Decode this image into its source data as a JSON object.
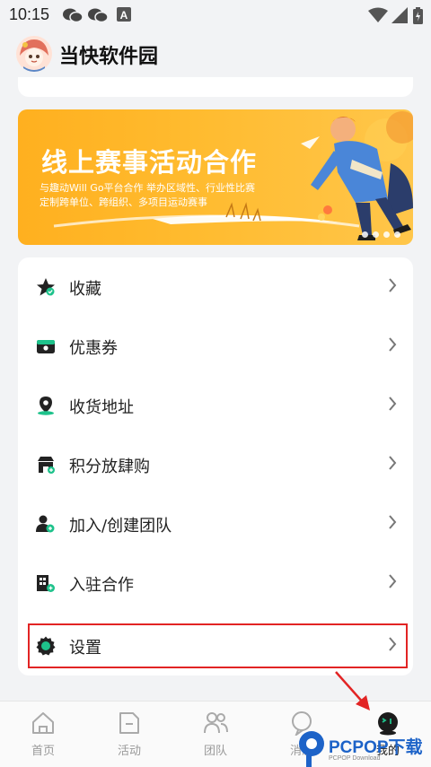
{
  "status_bar": {
    "time": "10:15",
    "icons": [
      "wechat-icon",
      "wechat-icon",
      "a-notification-icon",
      "wifi-icon",
      "signal-icon",
      "battery-icon"
    ]
  },
  "header": {
    "title": "当快软件园",
    "avatar": "avatar-cartoon-girl"
  },
  "banner": {
    "title": "线上赛事活动合作",
    "subtitle_line1": "与趣动Will Go平台合作 举办区域性、行业性比赛",
    "subtitle_line2": "定制跨单位、跨组织、多项目运动赛事",
    "page_count": 4
  },
  "menu": {
    "items": [
      {
        "label": "收藏",
        "icon": "star-favorite-icon"
      },
      {
        "label": "优惠券",
        "icon": "coupon-icon"
      },
      {
        "label": "收货地址",
        "icon": "location-pin-icon"
      },
      {
        "label": "积分放肆购",
        "icon": "points-shop-icon"
      },
      {
        "label": "加入/创建团队",
        "icon": "add-team-icon"
      },
      {
        "label": "入驻合作",
        "icon": "building-cooperation-icon"
      },
      {
        "label": "设置",
        "icon": "gear-icon"
      }
    ],
    "highlighted": "设置"
  },
  "tabbar": {
    "tabs": [
      {
        "label": "首页",
        "icon": "home-icon"
      },
      {
        "label": "活动",
        "icon": "activity-icon"
      },
      {
        "label": "团队",
        "icon": "team-icon"
      },
      {
        "label": "消息",
        "icon": "message-icon"
      },
      {
        "label": "我的",
        "icon": "robot-profile-icon"
      }
    ],
    "active": "我的"
  },
  "watermark": {
    "text": "PCPOP下载",
    "sub": "PCPOP Download"
  },
  "colors": {
    "accent_green": "#1ec28b",
    "banner_orange": "#ffb01f",
    "highlight_red": "#e22424",
    "watermark_blue": "#1d63c8"
  }
}
